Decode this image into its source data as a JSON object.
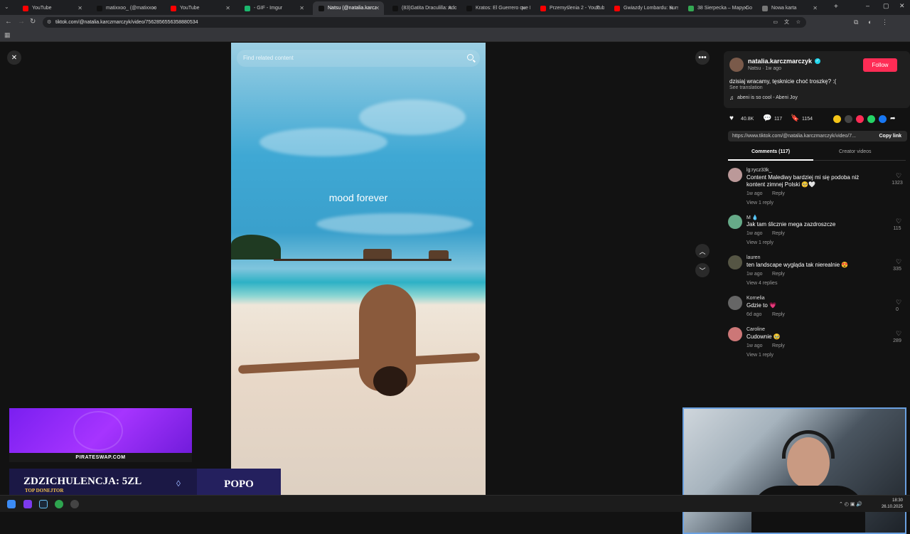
{
  "browser": {
    "tabs": [
      {
        "label": "YouTube",
        "favicon": "youtube-icon",
        "active": false
      },
      {
        "label": "matixxoo_ (@matixxoo",
        "favicon": "tiktok-icon",
        "active": false
      },
      {
        "label": "YouTube",
        "favicon": "youtube-icon",
        "active": false
      },
      {
        "label": "- GIF - Imgur",
        "favicon": "imgur-icon",
        "active": false
      },
      {
        "label": "Natsu (@natalia.karcz",
        "favicon": "tiktok-icon",
        "active": true
      },
      {
        "label": "(83)Gatita Draculilla: Ado",
        "favicon": "tiktok-icon",
        "active": false
      },
      {
        "label": "Kratos: El Guerrero que N",
        "favicon": "tiktok-icon",
        "active": false
      },
      {
        "label": "Przemyślenia 2 - YouTube",
        "favicon": "youtube-icon",
        "active": false
      },
      {
        "label": "Gwiazdy Lombardu: Kurs",
        "favicon": "youtube-icon",
        "active": false
      },
      {
        "label": "38 Sierpecka – Mapy Goo",
        "favicon": "maps-icon",
        "active": false
      },
      {
        "label": "Nowa karta",
        "favicon": "chrome-icon",
        "active": false
      }
    ],
    "url": "tiktok.com/@natalia.karczmarczyk/video/7562856556358880534"
  },
  "video": {
    "search_placeholder": "Find related content",
    "overlay_text": "mood forever"
  },
  "post": {
    "username": "natalia.karczmarczyk",
    "verified": true,
    "subline": "Natsu · 1w ago",
    "follow_label": "Follow",
    "caption": "dzisiaj wracamy, tęsknicie choć troszkę? :(",
    "see_translation": "See translation",
    "music": "abeni is so cool - Abeni Joy",
    "likes": "40.8K",
    "comments": "117",
    "saves": "1154",
    "link": "https://www.tiktok.com/@natalia.karczmarczyk/video/7...",
    "copy_link": "Copy link",
    "tab_comments": "Comments (117)",
    "tab_creator": "Creator videos"
  },
  "comments": [
    {
      "name": "lg:rycz33k_",
      "text": "Content Malediwy bardziej mi się podoba niż kontent zimnej Polski 🥺🤍",
      "time": "1w ago",
      "reply": "Reply",
      "view": "View 1 reply",
      "likes": "1323"
    },
    {
      "name": "M 💧",
      "text": "Jak tam ślicznie mega zazdroszcze",
      "time": "1w ago",
      "reply": "Reply",
      "view": "View 1 reply",
      "likes": "115"
    },
    {
      "name": "lauren",
      "text": "ten landscape wygląda tak nierealnie 😍",
      "time": "1w ago",
      "reply": "Reply",
      "view": "View 4 replies",
      "likes": "335"
    },
    {
      "name": "Kornelia",
      "text": "Gdzie to 💗",
      "time": "6d ago",
      "reply": "Reply",
      "view": "",
      "likes": "0"
    },
    {
      "name": "Caroline",
      "text": "Cudownie 🥹",
      "time": "1w ago",
      "reply": "Reply",
      "view": "View 1 reply",
      "likes": "289"
    }
  ],
  "stream": {
    "promo_label": "PIRATESWAP.COM",
    "donor_title": "ZDZICHULENCJA: 5ZL",
    "donor_sub": "TOP DONEJTOR",
    "popo": "POPO"
  },
  "clock": {
    "time": "18:30",
    "date": "26.10.2025"
  },
  "colors": {
    "accent": "#fe2c55",
    "panel": "#1f1f1f",
    "background": "#121212"
  }
}
